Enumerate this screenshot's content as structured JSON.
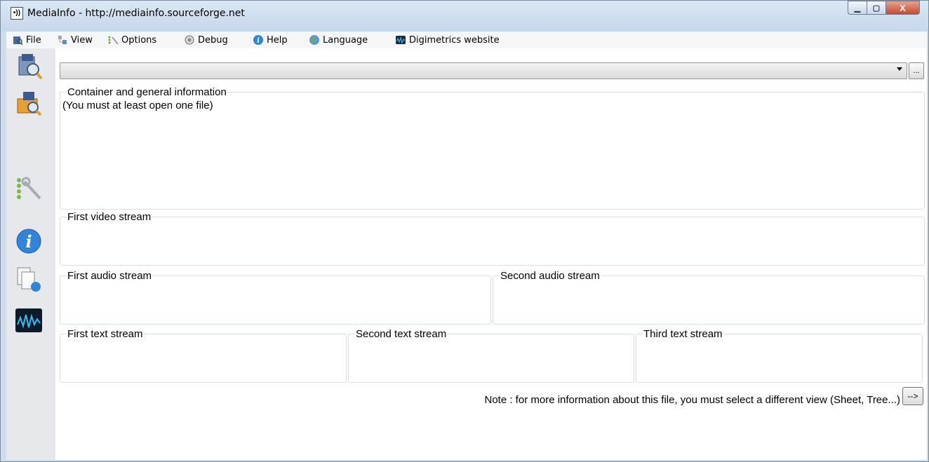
{
  "window": {
    "title": "MediaInfo - http://mediainfo.sourceforge.net",
    "app_icon_glyph": "•))",
    "minimize_glyph": "▁",
    "maximize_glyph": "▢",
    "close_glyph": "X"
  },
  "menu": {
    "items": [
      {
        "label": "File",
        "icon": "file-icon"
      },
      {
        "label": "View",
        "icon": "view-icon"
      },
      {
        "label": "Options",
        "icon": "options-icon"
      },
      {
        "label": "Debug",
        "icon": "debug-icon"
      },
      {
        "label": "Help",
        "icon": "help-icon"
      },
      {
        "label": "Language",
        "icon": "language-icon"
      },
      {
        "label": "Digimetrics website",
        "icon": "digimetrics-icon"
      }
    ]
  },
  "toolbar": {
    "file_combo_value": "",
    "browse_label": "..."
  },
  "sidebar": {
    "icons": [
      "open-file-icon",
      "open-folder-icon",
      "preferences-icon",
      "about-icon",
      "export-icon",
      "digimetrics-icon"
    ]
  },
  "panels": {
    "general": {
      "title": "Container and general information",
      "content": "(You must at least open one file)"
    },
    "video1": {
      "title": "First video stream"
    },
    "audio1": {
      "title": "First audio stream"
    },
    "audio2": {
      "title": "Second audio stream"
    },
    "text1": {
      "title": "First text stream"
    },
    "text2": {
      "title": "Second text stream"
    },
    "text3": {
      "title": "Third text stream"
    }
  },
  "footer": {
    "note": "Note : for more information about this file, you must select a different view (Sheet, Tree...)",
    "next_label": "-->"
  },
  "colors": {
    "title_bar": "#c6d7ea",
    "close_button": "#c54a30",
    "group_border": "#d5dfe5",
    "sidebar_bg": "#e6e8eb"
  }
}
